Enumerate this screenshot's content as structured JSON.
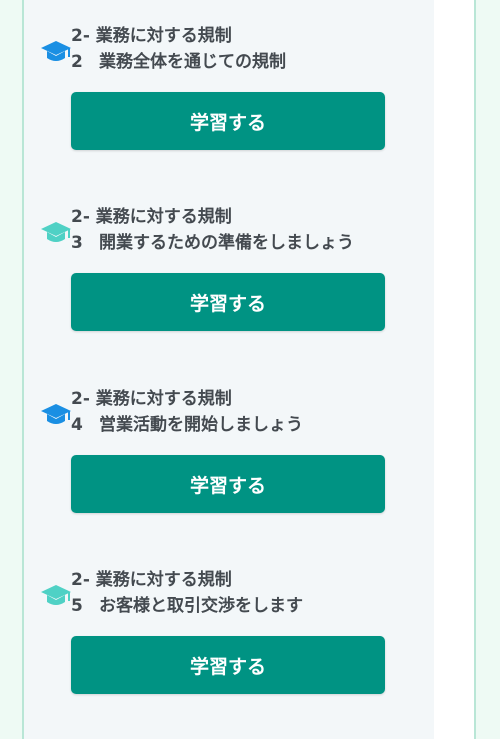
{
  "colors": {
    "button": "#009383",
    "icon_blue": "#1a8fe3",
    "icon_teal": "#4fd1c5",
    "heading_text": "#444a50"
  },
  "lessons": [
    {
      "category": "2- 業務に対する規制",
      "number": "2",
      "title": "業務全体を通じての規制",
      "button_label": "学習する",
      "icon": "graduation-cap-icon"
    },
    {
      "category": "2- 業務に対する規制",
      "number": "3",
      "title": "開業するための準備をしましょう",
      "button_label": "学習する",
      "icon": "graduation-cap-icon"
    },
    {
      "category": "2- 業務に対する規制",
      "number": "4",
      "title": "営業活動を開始しましょう",
      "button_label": "学習する",
      "icon": "graduation-cap-icon"
    },
    {
      "category": "2- 業務に対する規制",
      "number": "5",
      "title": "お客様と取引交渉をします",
      "button_label": "学習する",
      "icon": "graduation-cap-icon"
    }
  ]
}
